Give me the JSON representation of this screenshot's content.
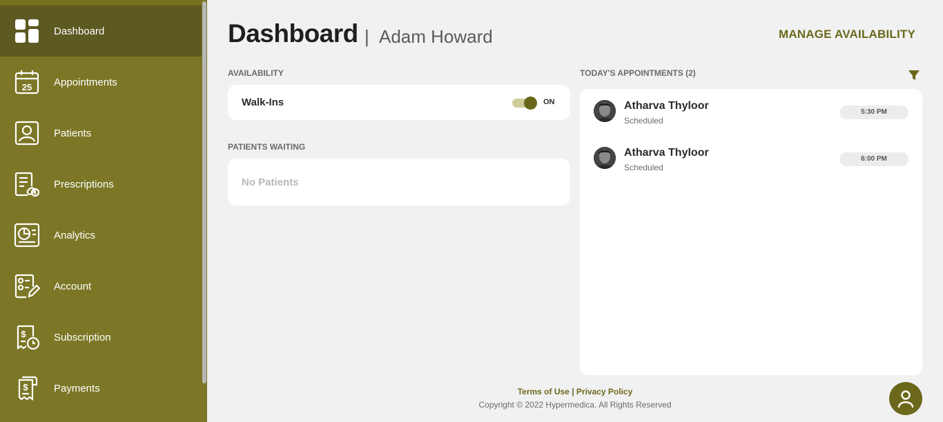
{
  "sidebar": {
    "items": [
      {
        "label": "Dashboard",
        "icon": "dashboard-icon",
        "active": true
      },
      {
        "label": "Appointments",
        "icon": "calendar-icon"
      },
      {
        "label": "Patients",
        "icon": "patient-icon"
      },
      {
        "label": "Prescriptions",
        "icon": "prescription-icon"
      },
      {
        "label": "Analytics",
        "icon": "analytics-icon"
      },
      {
        "label": "Account",
        "icon": "account-icon"
      },
      {
        "label": "Subscription",
        "icon": "subscription-icon"
      },
      {
        "label": "Payments",
        "icon": "payments-icon"
      }
    ],
    "calendar_day": "25"
  },
  "header": {
    "title": "Dashboard",
    "separator": "|",
    "user_name": "Adam Howard",
    "manage_label": "MANAGE AVAILABILITY"
  },
  "availability": {
    "section_label": "AVAILABILITY",
    "walkins_label": "Walk-Ins",
    "toggle_state": "ON"
  },
  "patients_waiting": {
    "section_label": "PATIENTS WAITING",
    "empty_text": "No Patients"
  },
  "appointments": {
    "section_label": "TODAY'S APPOINTMENTS (2)",
    "items": [
      {
        "name": "Atharva Thyloor",
        "status": "Scheduled",
        "time": "5:30 PM"
      },
      {
        "name": "Atharva Thyloor",
        "status": "Scheduled",
        "time": "6:00 PM"
      }
    ]
  },
  "footer": {
    "terms": "Terms of Use",
    "divider": "|",
    "privacy": "Privacy Policy",
    "copyright": "Copyright © 2022 Hypermedica. All Rights Reserved"
  },
  "colors": {
    "sidebar_bg": "#7b7726",
    "sidebar_active": "#5c5921",
    "accent": "#6b681c",
    "page_bg": "#f1f1f1"
  }
}
